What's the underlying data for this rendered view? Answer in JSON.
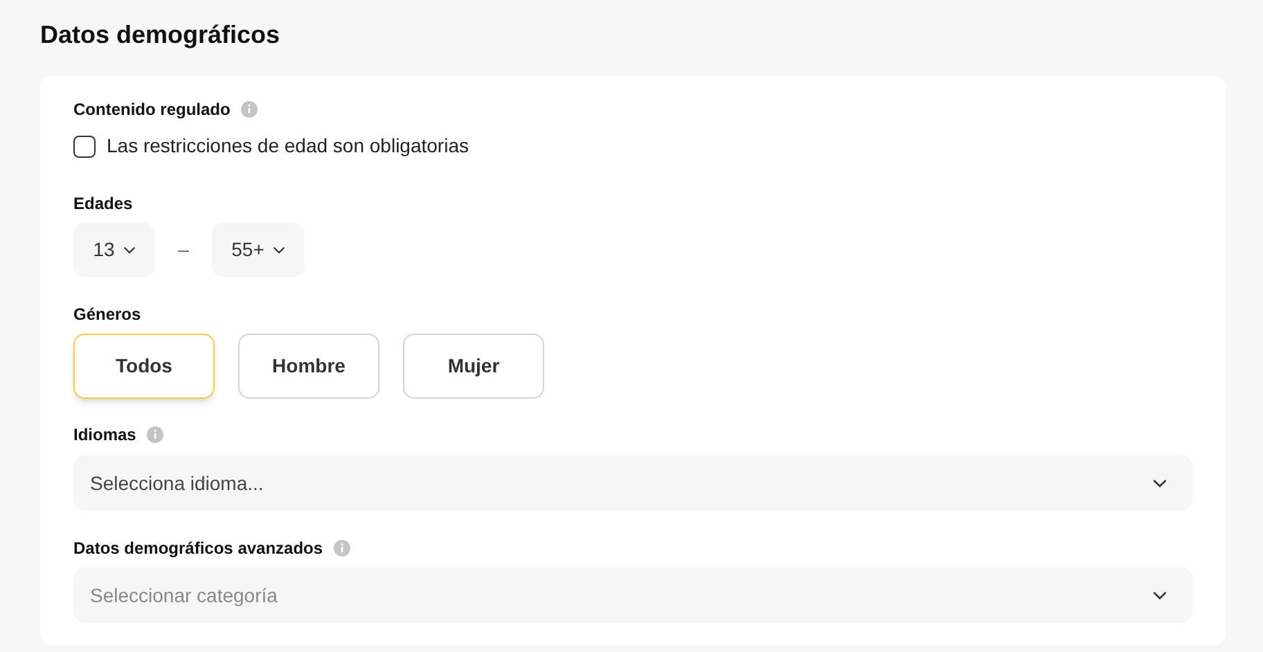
{
  "title": "Datos demográficos",
  "regulated": {
    "label": "Contenido regulado",
    "checkbox": {
      "label": "Las restricciones de edad son obligatorias",
      "checked": false
    }
  },
  "ages": {
    "label": "Edades",
    "min": "13",
    "separator": "–",
    "max": "55+"
  },
  "genders": {
    "label": "Géneros",
    "options": [
      {
        "label": "Todos",
        "selected": true
      },
      {
        "label": "Hombre",
        "selected": false
      },
      {
        "label": "Mujer",
        "selected": false
      }
    ]
  },
  "languages": {
    "label": "Idiomas",
    "placeholder": "Selecciona idioma..."
  },
  "advanced": {
    "label": "Datos demográficos avanzados",
    "placeholder": "Seleccionar categoría"
  }
}
